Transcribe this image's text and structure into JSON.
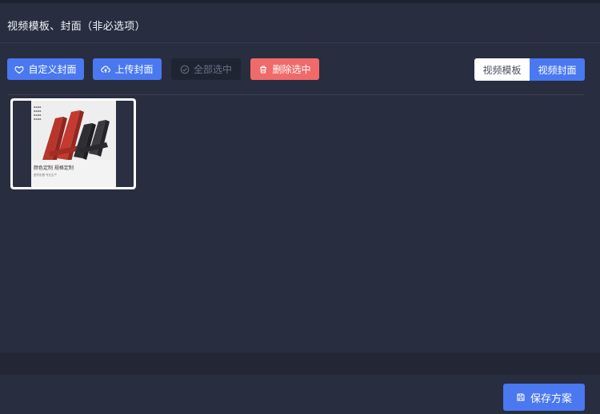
{
  "header": {
    "title": "视频模板、封面（非必选项）"
  },
  "toolbar": {
    "custom_cover_label": "自定义封面",
    "upload_cover_label": "上传封面",
    "select_all_label": "全部选中",
    "delete_selected_label": "删除选中",
    "tabs": [
      {
        "label": "视频模板",
        "active": false
      },
      {
        "label": "视频封面",
        "active": true
      }
    ]
  },
  "gallery": {
    "items": [
      {
        "caption": "颜色定制 规格定制",
        "subcaption": "型材定做 专业生产"
      }
    ]
  },
  "footer": {
    "save_label": "保存方案"
  },
  "colors": {
    "background": "#282d40",
    "accent": "#4a78f0",
    "danger": "#f06a6a",
    "disabled": "#1f2433"
  }
}
